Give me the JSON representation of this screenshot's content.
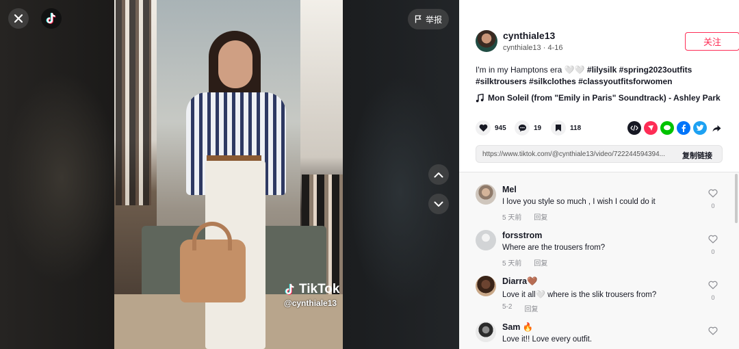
{
  "video": {
    "watermark_brand": "TikTok",
    "watermark_user": "@cynthiale13",
    "report_label": "举报"
  },
  "author": {
    "username": "cynthiale13",
    "handle": "cynthiale13",
    "date": "4-16",
    "follow_label": "关注"
  },
  "description": {
    "text": "I'm in my Hamptons era 🤍🤍 ",
    "hashtags": [
      "#lilysilk",
      "#spring2023outfits",
      "#silktrousers",
      "#silkclothes",
      "#classyoutfitsforwomen"
    ]
  },
  "music": {
    "title": "Mon Soleil (from \"Emily in Paris\" Soundtrack) - Ashley Park"
  },
  "stats": {
    "likes": "945",
    "comments": "19",
    "saves": "118"
  },
  "share": {
    "icons": [
      "embed-icon",
      "tiktok-friends-icon",
      "line-icon",
      "facebook-icon",
      "twitter-icon",
      "share-arrow-icon"
    ],
    "colors": [
      "#161823",
      "#fe2c55",
      "#00c300",
      "#0075fa",
      "#1da1f2",
      "#161823"
    ]
  },
  "link": {
    "url": "https://www.tiktok.com/@cynthiale13/video/722244594394...",
    "copy_label": "复制链接"
  },
  "comments": [
    {
      "name": "Mel",
      "text": "I love you style so much , I wish I could do it",
      "time": "5 天前",
      "reply": "回复",
      "likes": "0"
    },
    {
      "name": "forsstrom",
      "text": "Where are the trousers from?",
      "time": "5 天前",
      "reply": "回复",
      "likes": "0"
    },
    {
      "name": "Diarra🤎",
      "text": "Love it all🤍 where is the slik trousers from?",
      "time": "5-2",
      "reply": "回复",
      "likes": "0"
    },
    {
      "name": "Sam 🔥",
      "text": "Love it!! Love every outfit.",
      "time": "",
      "reply": "",
      "likes": ""
    }
  ],
  "colors": {
    "accent": "#fe2c55",
    "text": "#161823",
    "muted": "#8a8b91"
  }
}
